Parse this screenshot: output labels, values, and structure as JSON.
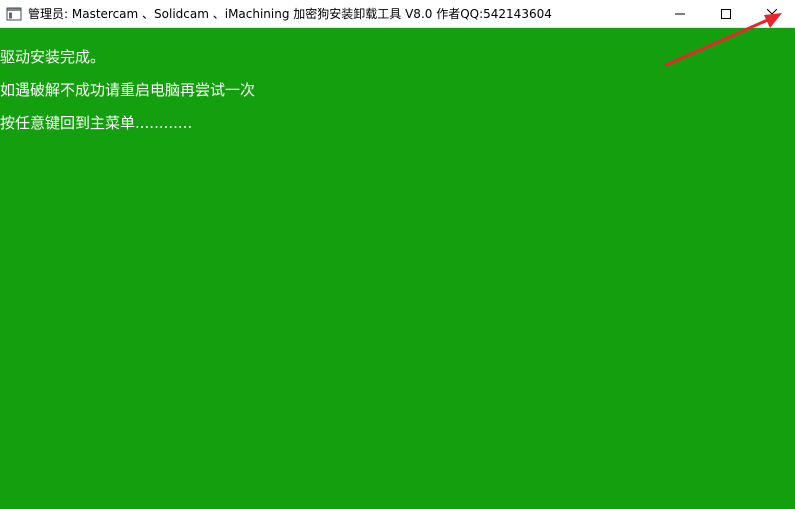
{
  "window": {
    "title": "管理员:  Mastercam 、Solidcam  、iMachining 加密狗安装卸载工具 V8.0  作者QQ:542143604",
    "background_color": "#14a00e",
    "icon": "console-app-icon"
  },
  "caption": {
    "minimize_icon": "minimize-icon",
    "maximize_icon": "maximize-icon",
    "close_icon": "close-icon"
  },
  "console": {
    "lines": [
      "驱动安装完成。",
      "如遇破解不成功请重启电脑再尝试一次",
      "按任意键回到主菜单............"
    ],
    "text_color": "#ffffff"
  },
  "annotation": {
    "arrow_color": "#e8262a",
    "points_to": "close-button"
  }
}
